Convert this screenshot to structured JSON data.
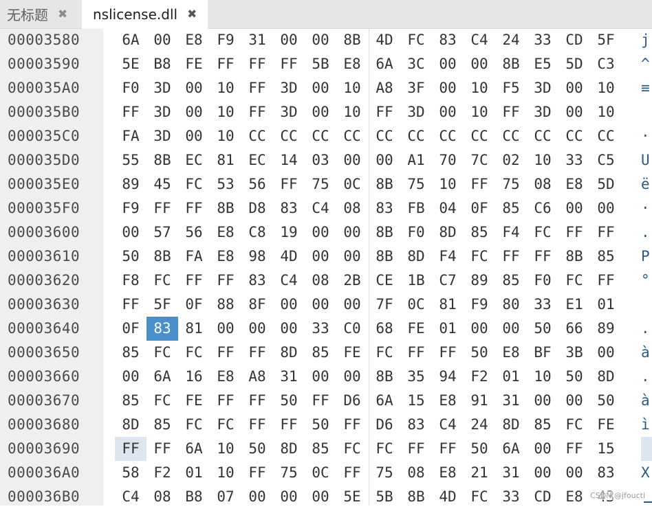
{
  "tabs": [
    {
      "label": "无标题",
      "close": "✖"
    },
    {
      "label": "nslicense.dll",
      "close": "✖"
    }
  ],
  "rows": [
    {
      "addr": "00003580",
      "bytes": [
        "6A",
        "00",
        "E8",
        "F9",
        "31",
        "00",
        "00",
        "8B",
        "4D",
        "FC",
        "83",
        "C4",
        "24",
        "33",
        "CD",
        "5F"
      ],
      "ascii": "j"
    },
    {
      "addr": "00003590",
      "bytes": [
        "5E",
        "B8",
        "FE",
        "FF",
        "FF",
        "FF",
        "5B",
        "E8",
        "6A",
        "3C",
        "00",
        "00",
        "8B",
        "E5",
        "5D",
        "C3"
      ],
      "ascii": "^"
    },
    {
      "addr": "000035A0",
      "bytes": [
        "F0",
        "3D",
        "00",
        "10",
        "FF",
        "3D",
        "00",
        "10",
        "A8",
        "3F",
        "00",
        "10",
        "F5",
        "3D",
        "00",
        "10"
      ],
      "ascii": "≡"
    },
    {
      "addr": "000035B0",
      "bytes": [
        "FF",
        "3D",
        "00",
        "10",
        "FF",
        "3D",
        "00",
        "10",
        "FF",
        "3D",
        "00",
        "10",
        "FF",
        "3D",
        "00",
        "10"
      ],
      "ascii": ""
    },
    {
      "addr": "000035C0",
      "bytes": [
        "FA",
        "3D",
        "00",
        "10",
        "CC",
        "CC",
        "CC",
        "CC",
        "CC",
        "CC",
        "CC",
        "CC",
        "CC",
        "CC",
        "CC",
        "CC"
      ],
      "ascii": "·"
    },
    {
      "addr": "000035D0",
      "bytes": [
        "55",
        "8B",
        "EC",
        "81",
        "EC",
        "14",
        "03",
        "00",
        "00",
        "A1",
        "70",
        "7C",
        "02",
        "10",
        "33",
        "C5"
      ],
      "ascii": "U"
    },
    {
      "addr": "000035E0",
      "bytes": [
        "89",
        "45",
        "FC",
        "53",
        "56",
        "FF",
        "75",
        "0C",
        "8B",
        "75",
        "10",
        "FF",
        "75",
        "08",
        "E8",
        "5D"
      ],
      "ascii": "ë"
    },
    {
      "addr": "000035F0",
      "bytes": [
        "F9",
        "FF",
        "FF",
        "8B",
        "D8",
        "83",
        "C4",
        "08",
        "83",
        "FB",
        "04",
        "0F",
        "85",
        "C6",
        "00",
        "00"
      ],
      "ascii": "·"
    },
    {
      "addr": "00003600",
      "bytes": [
        "00",
        "57",
        "56",
        "E8",
        "C8",
        "19",
        "00",
        "00",
        "8B",
        "F0",
        "8D",
        "85",
        "F4",
        "FC",
        "FF",
        "FF"
      ],
      "ascii": "."
    },
    {
      "addr": "00003610",
      "bytes": [
        "50",
        "8B",
        "FA",
        "E8",
        "98",
        "4D",
        "00",
        "00",
        "8B",
        "8D",
        "F4",
        "FC",
        "FF",
        "FF",
        "8B",
        "85"
      ],
      "ascii": "P"
    },
    {
      "addr": "00003620",
      "bytes": [
        "F8",
        "FC",
        "FF",
        "FF",
        "83",
        "C4",
        "08",
        "2B",
        "CE",
        "1B",
        "C7",
        "89",
        "85",
        "F0",
        "FC",
        "FF"
      ],
      "ascii": "°"
    },
    {
      "addr": "00003630",
      "bytes": [
        "FF",
        "5F",
        "0F",
        "88",
        "8F",
        "00",
        "00",
        "00",
        "7F",
        "0C",
        "81",
        "F9",
        "80",
        "33",
        "E1",
        "01"
      ],
      "ascii": ""
    },
    {
      "addr": "00003640",
      "bytes": [
        "0F",
        "83",
        "81",
        "00",
        "00",
        "00",
        "33",
        "C0",
        "68",
        "FE",
        "01",
        "00",
        "00",
        "50",
        "66",
        "89"
      ],
      "ascii": "."
    },
    {
      "addr": "00003650",
      "bytes": [
        "85",
        "FC",
        "FC",
        "FF",
        "FF",
        "8D",
        "85",
        "FE",
        "FC",
        "FF",
        "FF",
        "50",
        "E8",
        "BF",
        "3B",
        "00"
      ],
      "ascii": "à"
    },
    {
      "addr": "00003660",
      "bytes": [
        "00",
        "6A",
        "16",
        "E8",
        "A8",
        "31",
        "00",
        "00",
        "8B",
        "35",
        "94",
        "F2",
        "01",
        "10",
        "50",
        "8D"
      ],
      "ascii": "."
    },
    {
      "addr": "00003670",
      "bytes": [
        "85",
        "FC",
        "FE",
        "FF",
        "FF",
        "50",
        "FF",
        "D6",
        "6A",
        "15",
        "E8",
        "91",
        "31",
        "00",
        "00",
        "50"
      ],
      "ascii": "à"
    },
    {
      "addr": "00003680",
      "bytes": [
        "8D",
        "85",
        "FC",
        "FC",
        "FF",
        "FF",
        "50",
        "FF",
        "D6",
        "83",
        "C4",
        "24",
        "8D",
        "85",
        "FC",
        "FE"
      ],
      "ascii": "ì"
    },
    {
      "addr": "00003690",
      "bytes": [
        "FF",
        "FF",
        "6A",
        "10",
        "50",
        "8D",
        "85",
        "FC",
        "FC",
        "FF",
        "FF",
        "50",
        "6A",
        "00",
        "FF",
        "15"
      ],
      "ascii": ""
    },
    {
      "addr": "000036A0",
      "bytes": [
        "58",
        "F2",
        "01",
        "10",
        "FF",
        "75",
        "0C",
        "FF",
        "75",
        "08",
        "E8",
        "21",
        "31",
        "00",
        "00",
        "83"
      ],
      "ascii": "X"
    },
    {
      "addr": "000036B0",
      "bytes": [
        "C4",
        "08",
        "B8",
        "07",
        "00",
        "00",
        "00",
        "5E",
        "5B",
        "8B",
        "4D",
        "FC",
        "33",
        "CD",
        "E8",
        "43"
      ],
      "ascii": ""
    }
  ],
  "selection": {
    "row": 12,
    "col": 1
  },
  "highlight": {
    "row": 17,
    "col": 0
  },
  "watermark": "CSDN @jfoucti"
}
